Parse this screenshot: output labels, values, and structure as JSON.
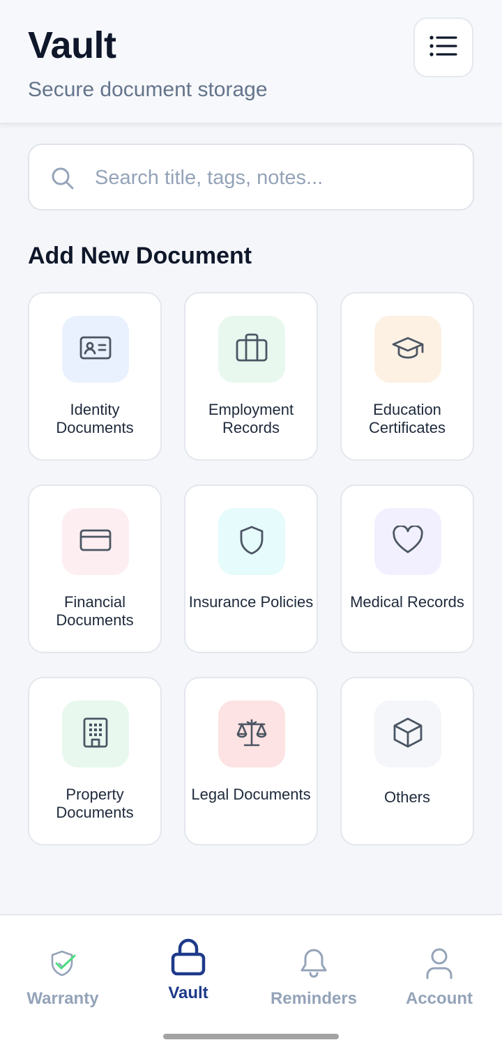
{
  "header": {
    "title": "Vault",
    "subtitle": "Secure document storage",
    "menu_icon": "list-icon"
  },
  "search": {
    "placeholder": "Search title, tags, notes...",
    "value": "",
    "icon": "search-icon"
  },
  "section": {
    "title": "Add New Document"
  },
  "categories": [
    {
      "label": "Identity Documents",
      "icon": "id-card-icon",
      "bg": "#eaf1fe"
    },
    {
      "label": "Employment Records",
      "icon": "briefcase-icon",
      "bg": "#e8f8ef"
    },
    {
      "label": "Education Certificates",
      "icon": "graduation-cap-icon",
      "bg": "#fdf1e4"
    },
    {
      "label": "Financial Documents",
      "icon": "credit-card-icon",
      "bg": "#fdeff1"
    },
    {
      "label": "Insurance Policies",
      "icon": "shield-icon",
      "bg": "#e6fbfb"
    },
    {
      "label": "Medical Records",
      "icon": "heart-icon",
      "bg": "#f2f0fe"
    },
    {
      "label": "Property Documents",
      "icon": "building-icon",
      "bg": "#e8f8ef"
    },
    {
      "label": "Legal Documents",
      "icon": "scale-icon",
      "bg": "#fde3e3"
    },
    {
      "label": "Others",
      "icon": "box-icon",
      "bg": "#f4f6f9"
    }
  ],
  "nav": [
    {
      "label": "Warranty",
      "icon": "shield-check-icon",
      "active": false
    },
    {
      "label": "Vault",
      "icon": "lock-icon",
      "active": true
    },
    {
      "label": "Reminders",
      "icon": "bell-icon",
      "active": false
    },
    {
      "label": "Account",
      "icon": "user-icon",
      "active": false
    }
  ],
  "colors": {
    "active_nav": "#1e3a8a",
    "inactive_nav": "#94a3b8",
    "icon_stroke": "#4b5563",
    "warranty_check": "#4ade80"
  }
}
